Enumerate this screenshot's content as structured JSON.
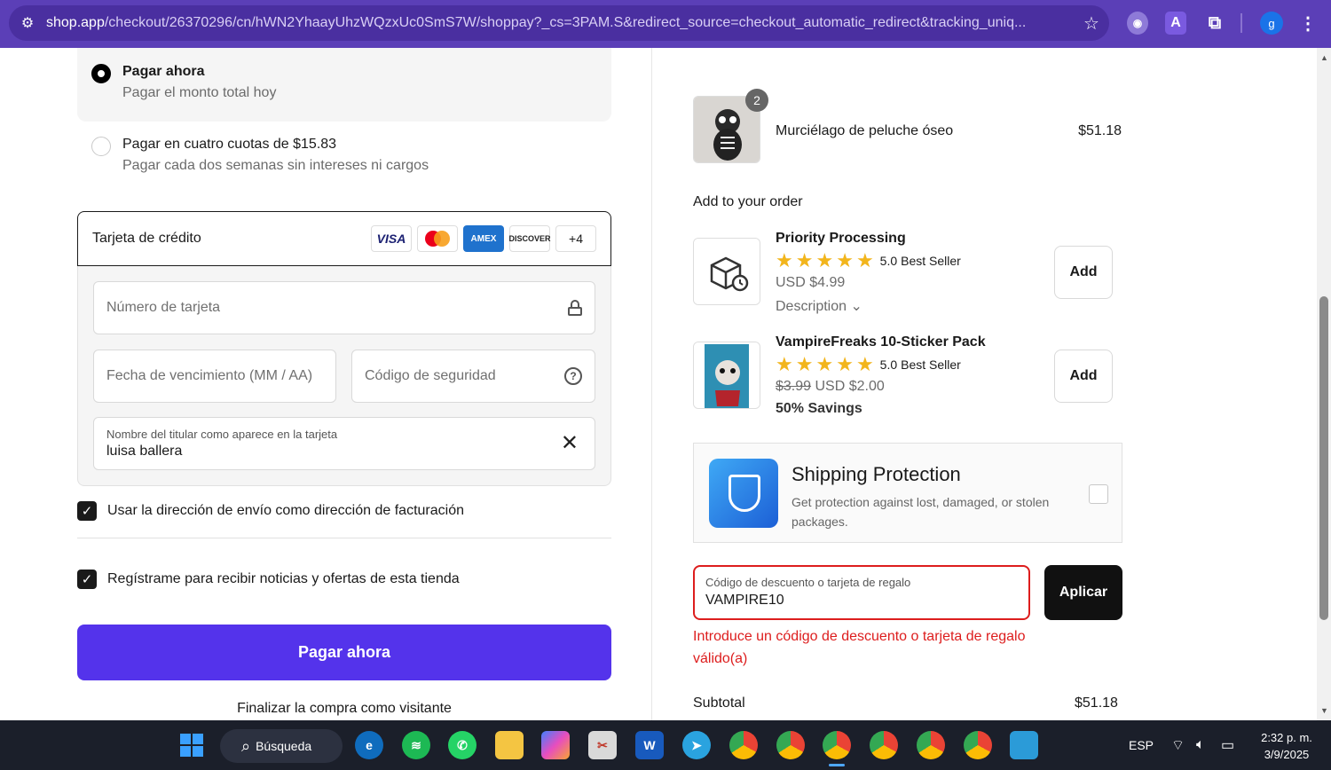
{
  "browser": {
    "url_main": "shop.app",
    "url_rest": "/checkout/26370296/cn/hWN2YhaayUhzWQzxUc0SmS7W/shoppay?_cs=3PAM.S&redirect_source=checkout_automatic_redirect&tracking_uniq...",
    "extension_a": "A",
    "profile_initial": "g"
  },
  "payment_options": {
    "pay_now_title": "Pagar ahora",
    "pay_now_sub": "Pagar el monto total hoy",
    "installments_title": "Pagar en cuatro cuotas de $15.83",
    "installments_sub": "Pagar cada dos semanas sin intereses ni cargos"
  },
  "card": {
    "label": "Tarjeta de crédito",
    "logos": [
      "VISA",
      "mastercard",
      "AMEX",
      "DISCOVER"
    ],
    "more_label": "+4",
    "number_placeholder": "Número de tarjeta",
    "expiry_placeholder": "Fecha de vencimiento (MM / AA)",
    "security_placeholder": "Código de seguridad",
    "name_label": "Nombre del titular como aparece en la tarjeta",
    "name_value": "luisa ballera"
  },
  "checkboxes": {
    "billing_label": "Usar la dirección de envío como dirección de facturación",
    "billing_checked": true,
    "newsletter_label": "Regístrame para recibir noticias y ofertas de esta tienda",
    "newsletter_checked": true
  },
  "actions": {
    "pay_button": "Pagar ahora",
    "guest_link": "Finalizar la compra como visitante"
  },
  "order": {
    "item_name": "Murciélago de peluche óseo",
    "item_qty": "2",
    "item_price": "$51.18",
    "add_label": "Add to your order",
    "upsells": [
      {
        "title": "Priority Processing",
        "rating": "5.0",
        "badge": "Best Seller",
        "price": "USD $4.99",
        "extra": "Description",
        "button": "Add"
      },
      {
        "title": "VampireFreaks 10-Sticker Pack",
        "rating": "5.0",
        "badge": "Best Seller",
        "old_price": "$3.99",
        "price": "USD $2.00",
        "savings": "50% Savings",
        "button": "Add"
      }
    ],
    "protection": {
      "title": "Shipping Protection",
      "subtitle": "Get protection against lost, damaged, or stolen packages."
    },
    "discount": {
      "label": "Código de descuento o tarjeta de regalo",
      "value": "VAMPIRE10",
      "apply": "Aplicar",
      "error": "Introduce un código de descuento o tarjeta de regalo válido(a)"
    },
    "subtotal_label": "Subtotal",
    "subtotal_value": "$51.18"
  },
  "taskbar": {
    "search_label": "Búsqueda",
    "language": "ESP",
    "time": "2:32 p. m.",
    "date": "3/9/2025"
  },
  "colors": {
    "accent": "#5433eb",
    "browser": "#5b3fb7",
    "error": "#dd1d1d",
    "star": "#f2b51c"
  }
}
